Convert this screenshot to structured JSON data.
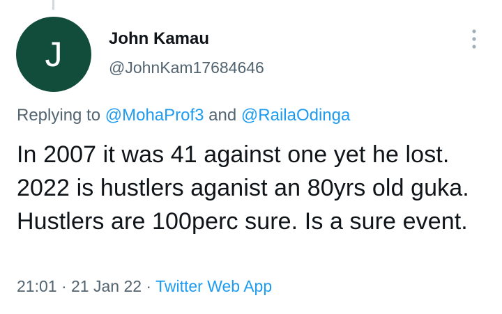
{
  "author": {
    "avatar_initial": "J",
    "avatar_color": "#114d3a",
    "display_name": "John Kamau",
    "handle": "@JohnKam17684646"
  },
  "reply": {
    "prefix": "Replying to ",
    "mention_1": "@MohaProf3",
    "connector": " and ",
    "mention_2": "@RailaOdinga"
  },
  "tweet": {
    "text": "In 2007 it was 41 against one yet he lost. 2022 is hustlers aganist an 80yrs old guka. Hustlers are 100perc sure. Is a sure event."
  },
  "meta": {
    "time": "21:01",
    "separator": " · ",
    "date": "21 Jan 22",
    "source": "Twitter Web App"
  },
  "icons": {
    "more": "more-vertical-icon"
  },
  "colors": {
    "link": "#1d9bf0",
    "secondary_text": "#536471",
    "primary_text": "#0f1419"
  }
}
